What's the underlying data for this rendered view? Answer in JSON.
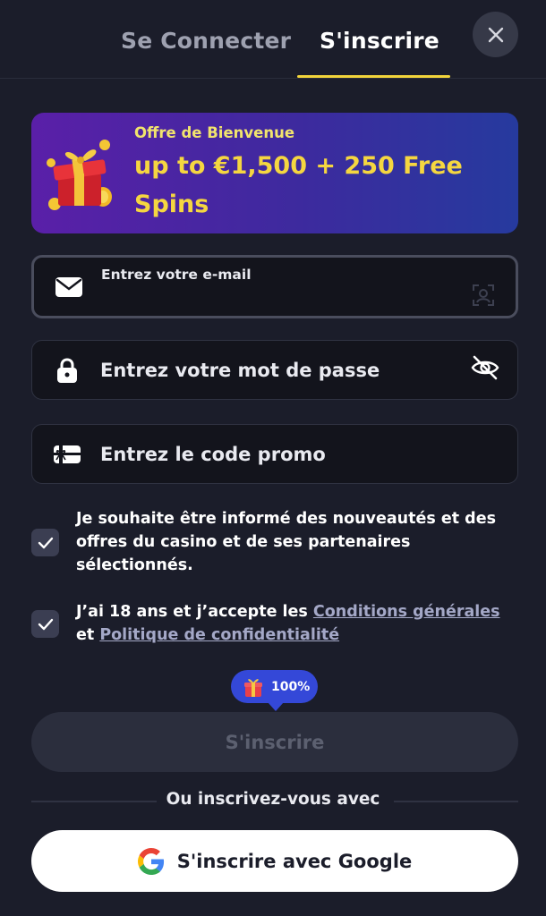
{
  "tabs": {
    "login_label": "Se Connecter",
    "register_label": "S'inscrire",
    "active": "register",
    "accent_color": "#f2d43b"
  },
  "close_icon": "close-icon",
  "banner": {
    "subtitle": "Offre de Bienvenue",
    "title": "up to €1,500 + 250 Free Spins",
    "icon": "gift-box-icon"
  },
  "form": {
    "email": {
      "placeholder": "Entrez votre e-mail",
      "value": "",
      "icon": "envelope-icon",
      "right_icon": "autofill-icon"
    },
    "password": {
      "placeholder": "Entrez votre mot de passe",
      "value": "",
      "icon": "lock-icon",
      "right_icon": "eye-off-icon"
    },
    "promo": {
      "placeholder": "Entrez le code promo",
      "value": "",
      "icon": "gift-card-icon"
    }
  },
  "consents": {
    "newsletter": {
      "checked": true,
      "text": "Je souhaite être informé des nouveautés et des offres du casino et de ses partenaires sélectionnés."
    },
    "terms": {
      "checked": true,
      "prefix": "J’ai 18 ans et j’accepte les ",
      "link_terms": "Conditions générales",
      "middle": " et ",
      "link_privacy": "Politique de confidentialité"
    }
  },
  "bonus_badge": {
    "text": "100%",
    "icon": "gift-icon"
  },
  "submit_label": "S'inscrire",
  "divider_text": "Ou inscrivez-vous avec",
  "google": {
    "label": "S'inscrire avec Google",
    "icon": "google-icon"
  }
}
